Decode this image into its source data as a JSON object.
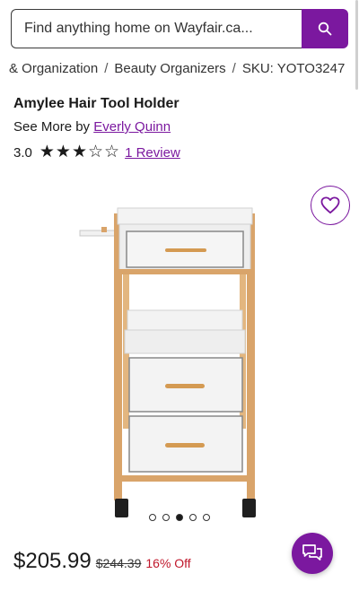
{
  "search": {
    "placeholder": "Find anything home on Wayfair.ca...",
    "button_icon": "search-icon"
  },
  "breadcrumb": {
    "items": [
      "& Organization",
      "Beauty Organizers"
    ],
    "sku": "SKU: YOTO3247",
    "separator": "/"
  },
  "product": {
    "title": "Amylee Hair Tool Holder",
    "see_more_prefix": "See More by",
    "brand": "Everly Quinn",
    "rating_value": "3.0",
    "stars_filled": 3,
    "stars_total": 5,
    "review_link": "1 Review"
  },
  "gallery": {
    "image_count": 5,
    "active_index": 2,
    "favorite_icon": "heart-icon"
  },
  "pricing": {
    "price": "$205.99",
    "original_price": "$244.39",
    "discount": "16% Off"
  },
  "chat": {
    "icon": "chat-bubbles-icon"
  },
  "colors": {
    "brand_purple": "#7b189f",
    "discount_red": "#c0172b",
    "wood": "#d9a46a"
  }
}
